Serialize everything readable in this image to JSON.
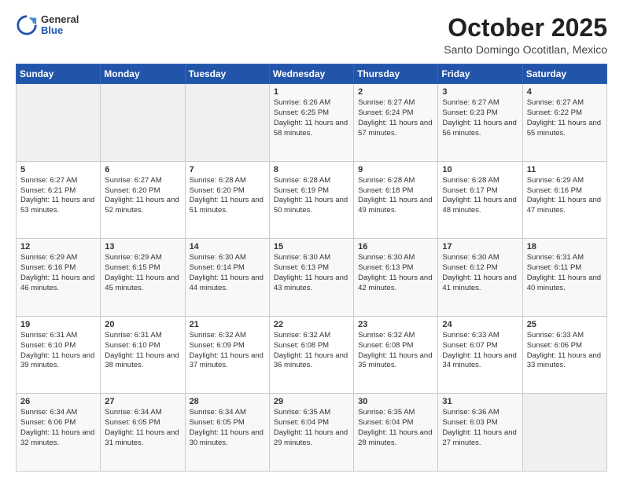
{
  "header": {
    "logo_general": "General",
    "logo_blue": "Blue",
    "month_title": "October 2025",
    "location": "Santo Domingo Ocotitlan, Mexico"
  },
  "weekdays": [
    "Sunday",
    "Monday",
    "Tuesday",
    "Wednesday",
    "Thursday",
    "Friday",
    "Saturday"
  ],
  "weeks": [
    [
      {
        "day": "",
        "sunrise": "",
        "sunset": "",
        "daylight": ""
      },
      {
        "day": "",
        "sunrise": "",
        "sunset": "",
        "daylight": ""
      },
      {
        "day": "",
        "sunrise": "",
        "sunset": "",
        "daylight": ""
      },
      {
        "day": "1",
        "sunrise": "Sunrise: 6:26 AM",
        "sunset": "Sunset: 6:25 PM",
        "daylight": "Daylight: 11 hours and 58 minutes."
      },
      {
        "day": "2",
        "sunrise": "Sunrise: 6:27 AM",
        "sunset": "Sunset: 6:24 PM",
        "daylight": "Daylight: 11 hours and 57 minutes."
      },
      {
        "day": "3",
        "sunrise": "Sunrise: 6:27 AM",
        "sunset": "Sunset: 6:23 PM",
        "daylight": "Daylight: 11 hours and 56 minutes."
      },
      {
        "day": "4",
        "sunrise": "Sunrise: 6:27 AM",
        "sunset": "Sunset: 6:22 PM",
        "daylight": "Daylight: 11 hours and 55 minutes."
      }
    ],
    [
      {
        "day": "5",
        "sunrise": "Sunrise: 6:27 AM",
        "sunset": "Sunset: 6:21 PM",
        "daylight": "Daylight: 11 hours and 53 minutes."
      },
      {
        "day": "6",
        "sunrise": "Sunrise: 6:27 AM",
        "sunset": "Sunset: 6:20 PM",
        "daylight": "Daylight: 11 hours and 52 minutes."
      },
      {
        "day": "7",
        "sunrise": "Sunrise: 6:28 AM",
        "sunset": "Sunset: 6:20 PM",
        "daylight": "Daylight: 11 hours and 51 minutes."
      },
      {
        "day": "8",
        "sunrise": "Sunrise: 6:28 AM",
        "sunset": "Sunset: 6:19 PM",
        "daylight": "Daylight: 11 hours and 50 minutes."
      },
      {
        "day": "9",
        "sunrise": "Sunrise: 6:28 AM",
        "sunset": "Sunset: 6:18 PM",
        "daylight": "Daylight: 11 hours and 49 minutes."
      },
      {
        "day": "10",
        "sunrise": "Sunrise: 6:28 AM",
        "sunset": "Sunset: 6:17 PM",
        "daylight": "Daylight: 11 hours and 48 minutes."
      },
      {
        "day": "11",
        "sunrise": "Sunrise: 6:29 AM",
        "sunset": "Sunset: 6:16 PM",
        "daylight": "Daylight: 11 hours and 47 minutes."
      }
    ],
    [
      {
        "day": "12",
        "sunrise": "Sunrise: 6:29 AM",
        "sunset": "Sunset: 6:16 PM",
        "daylight": "Daylight: 11 hours and 46 minutes."
      },
      {
        "day": "13",
        "sunrise": "Sunrise: 6:29 AM",
        "sunset": "Sunset: 6:15 PM",
        "daylight": "Daylight: 11 hours and 45 minutes."
      },
      {
        "day": "14",
        "sunrise": "Sunrise: 6:30 AM",
        "sunset": "Sunset: 6:14 PM",
        "daylight": "Daylight: 11 hours and 44 minutes."
      },
      {
        "day": "15",
        "sunrise": "Sunrise: 6:30 AM",
        "sunset": "Sunset: 6:13 PM",
        "daylight": "Daylight: 11 hours and 43 minutes."
      },
      {
        "day": "16",
        "sunrise": "Sunrise: 6:30 AM",
        "sunset": "Sunset: 6:13 PM",
        "daylight": "Daylight: 11 hours and 42 minutes."
      },
      {
        "day": "17",
        "sunrise": "Sunrise: 6:30 AM",
        "sunset": "Sunset: 6:12 PM",
        "daylight": "Daylight: 11 hours and 41 minutes."
      },
      {
        "day": "18",
        "sunrise": "Sunrise: 6:31 AM",
        "sunset": "Sunset: 6:11 PM",
        "daylight": "Daylight: 11 hours and 40 minutes."
      }
    ],
    [
      {
        "day": "19",
        "sunrise": "Sunrise: 6:31 AM",
        "sunset": "Sunset: 6:10 PM",
        "daylight": "Daylight: 11 hours and 39 minutes."
      },
      {
        "day": "20",
        "sunrise": "Sunrise: 6:31 AM",
        "sunset": "Sunset: 6:10 PM",
        "daylight": "Daylight: 11 hours and 38 minutes."
      },
      {
        "day": "21",
        "sunrise": "Sunrise: 6:32 AM",
        "sunset": "Sunset: 6:09 PM",
        "daylight": "Daylight: 11 hours and 37 minutes."
      },
      {
        "day": "22",
        "sunrise": "Sunrise: 6:32 AM",
        "sunset": "Sunset: 6:08 PM",
        "daylight": "Daylight: 11 hours and 36 minutes."
      },
      {
        "day": "23",
        "sunrise": "Sunrise: 6:32 AM",
        "sunset": "Sunset: 6:08 PM",
        "daylight": "Daylight: 11 hours and 35 minutes."
      },
      {
        "day": "24",
        "sunrise": "Sunrise: 6:33 AM",
        "sunset": "Sunset: 6:07 PM",
        "daylight": "Daylight: 11 hours and 34 minutes."
      },
      {
        "day": "25",
        "sunrise": "Sunrise: 6:33 AM",
        "sunset": "Sunset: 6:06 PM",
        "daylight": "Daylight: 11 hours and 33 minutes."
      }
    ],
    [
      {
        "day": "26",
        "sunrise": "Sunrise: 6:34 AM",
        "sunset": "Sunset: 6:06 PM",
        "daylight": "Daylight: 11 hours and 32 minutes."
      },
      {
        "day": "27",
        "sunrise": "Sunrise: 6:34 AM",
        "sunset": "Sunset: 6:05 PM",
        "daylight": "Daylight: 11 hours and 31 minutes."
      },
      {
        "day": "28",
        "sunrise": "Sunrise: 6:34 AM",
        "sunset": "Sunset: 6:05 PM",
        "daylight": "Daylight: 11 hours and 30 minutes."
      },
      {
        "day": "29",
        "sunrise": "Sunrise: 6:35 AM",
        "sunset": "Sunset: 6:04 PM",
        "daylight": "Daylight: 11 hours and 29 minutes."
      },
      {
        "day": "30",
        "sunrise": "Sunrise: 6:35 AM",
        "sunset": "Sunset: 6:04 PM",
        "daylight": "Daylight: 11 hours and 28 minutes."
      },
      {
        "day": "31",
        "sunrise": "Sunrise: 6:36 AM",
        "sunset": "Sunset: 6:03 PM",
        "daylight": "Daylight: 11 hours and 27 minutes."
      },
      {
        "day": "",
        "sunrise": "",
        "sunset": "",
        "daylight": ""
      }
    ]
  ]
}
